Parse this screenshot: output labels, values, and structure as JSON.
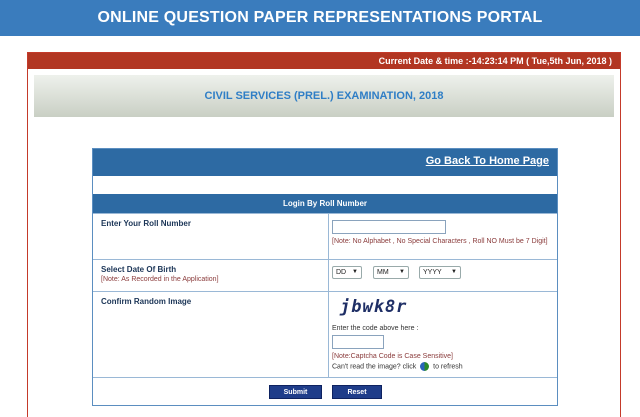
{
  "portal_title": "ONLINE QUESTION PAPER REPRESENTATIONS PORTAL",
  "current_datetime": "Current Date & time :-14:23:14 PM ( Tue,5th Jun, 2018 )",
  "exam_title": "CIVIL SERVICES (PREL.) EXAMINATION, 2018",
  "home_link": "Go Back To Home Page",
  "login": {
    "title": "Login By Roll Number",
    "roll_label": "Enter Your Roll Number",
    "roll_value": "",
    "roll_note": "[Note: No Alphabet , No Special Characters , Roll NO Must be 7 Digit]",
    "dob_label": "Select Date Of Birth",
    "dob_note": "[Note: As Recorded in the Application]",
    "dob_day": "DD",
    "dob_month": "MM",
    "dob_year": "YYYY",
    "captcha_label": "Confirm Random Image",
    "captcha_text": "jbwk8r",
    "captcha_prompt": "Enter the code above here :",
    "captcha_value": "",
    "captcha_note": "[Note:Captcha Code is Case Sensitive]",
    "refresh_prefix": "Can't read the image? click",
    "refresh_suffix": "to refresh",
    "submit_label": "Submit",
    "reset_label": "Reset"
  },
  "colors": {
    "header_blue": "#3a7cbd",
    "date_bar_red": "#b23622",
    "exam_title_blue": "#2f7ec6",
    "card_header_blue": "#2d6aa3",
    "button_navy": "#1f3d8a"
  }
}
